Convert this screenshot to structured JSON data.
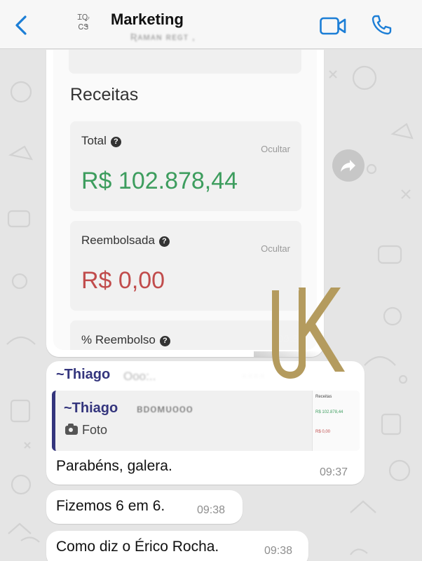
{
  "header": {
    "back_label": "back",
    "avatar_text": "ꞮꝘ ᏟᏕ",
    "title": "Marketing",
    "subtitle": "Ʀᴀᴍᴀɴ ʀᴇɢᴛ ,",
    "icons": {
      "back": "chevron-left-icon",
      "video": "video-call-icon",
      "call": "phone-icon"
    }
  },
  "image_message": {
    "section_title": "Receitas",
    "cards": [
      {
        "label": "Total",
        "hide": "Ocultar",
        "value": "R$ 102.878,44",
        "value_color": "#3d9d5e"
      },
      {
        "label": "Reembolsada",
        "hide": "Ocultar",
        "value": "R$ 0,00",
        "value_color": "#c14c4c"
      },
      {
        "label": "% Reembolso"
      }
    ],
    "time": "09:3"
  },
  "reply_message": {
    "sender": "~Thiago",
    "sender_extra": "Ooo:..",
    "sender_extra2": "·  ·  ·  ·",
    "quote": {
      "sender": "~Thiago",
      "sender_extra": "ʙᴅᴏᴍᴜᴏᴏᴏ",
      "type": "Foto",
      "thumb": {
        "title": "Receitas",
        "total": "R$ 102.878,44",
        "reemb": "R$ 0,00"
      }
    },
    "text": "Parabéns, galera.",
    "time": "09:37"
  },
  "messages": [
    {
      "text": "Fizemos 6 em 6.",
      "time": "09:38"
    },
    {
      "text": "Como diz o Érico Rocha.",
      "time": "09:38"
    }
  ],
  "watermark": "UK",
  "colors": {
    "accent": "#1c7ed6",
    "sender": "#34357d",
    "watermark": "#b49b5e"
  }
}
